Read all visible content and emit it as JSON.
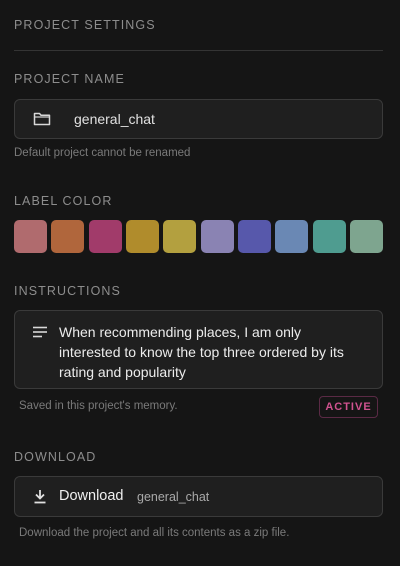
{
  "header": {
    "title": "PROJECT SETTINGS"
  },
  "project_name": {
    "label": "PROJECT NAME",
    "value": "general_chat",
    "hint": "Default project cannot be renamed"
  },
  "label_color": {
    "label": "LABEL COLOR",
    "swatches": [
      "#b06b6e",
      "#b0663c",
      "#a13b6a",
      "#b08c2c",
      "#b3a03f",
      "#8a83b3",
      "#5758ab",
      "#6a88b4",
      "#4f9c90",
      "#7ea58f"
    ]
  },
  "instructions": {
    "label": "INSTRUCTIONS",
    "line1": "When recommending places, I am only",
    "line2": "interested to know the top three ordered by its",
    "line3": "rating and popularity",
    "saved_note": "Saved in this project's memory.",
    "status_badge": "ACTIVE",
    "badge_color": "#d0528f"
  },
  "download": {
    "label": "DOWNLOAD",
    "button_label": "Download",
    "project_name": "general_chat",
    "hint": "Download the project and all its contents as a zip file."
  },
  "icons": {
    "folder": "folder-icon",
    "instructions": "lines-icon",
    "download": "download-icon"
  }
}
